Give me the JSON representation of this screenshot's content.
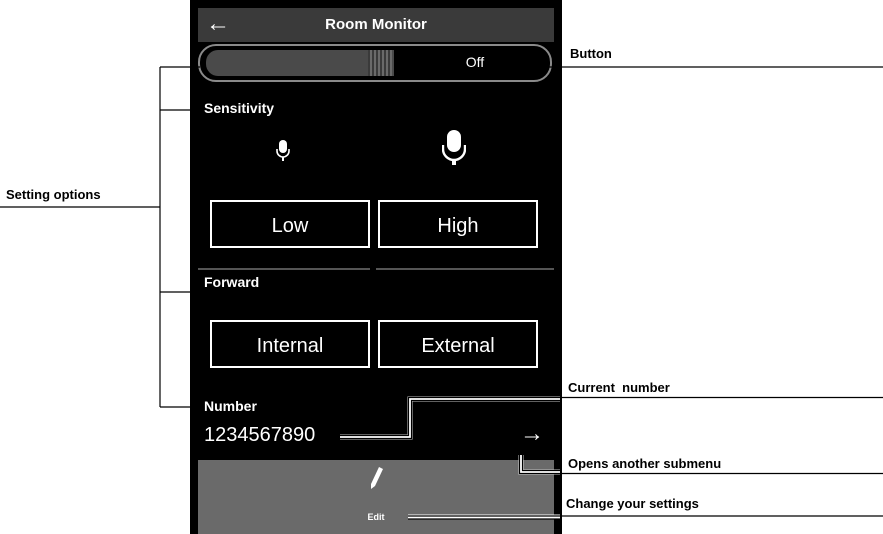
{
  "screen": {
    "back_icon": "arrow-left-icon",
    "title": "Room Monitor",
    "toggle": {
      "state_label": "Off"
    },
    "sensitivity": {
      "label": "Sensitivity",
      "low": "Low",
      "high": "High"
    },
    "forward": {
      "label": "Forward",
      "internal": "Internal",
      "external": "External"
    },
    "number": {
      "label": "Number",
      "value": "1234567890",
      "arrow_icon": "arrow-right-icon"
    },
    "edit": {
      "label": "Edit",
      "icon": "pencil-icon"
    }
  },
  "callouts": {
    "button": "Button",
    "setting_options": "Setting options",
    "current_number": "Current  number",
    "opens_submenu": "Opens another submenu",
    "change_settings": "Change your settings"
  },
  "colors": {
    "screen_bg": "#000000",
    "title_bar": "#3a3a3a",
    "edit_bar": "#6a6a6a",
    "toggle_fill": "#4a4a4a"
  }
}
